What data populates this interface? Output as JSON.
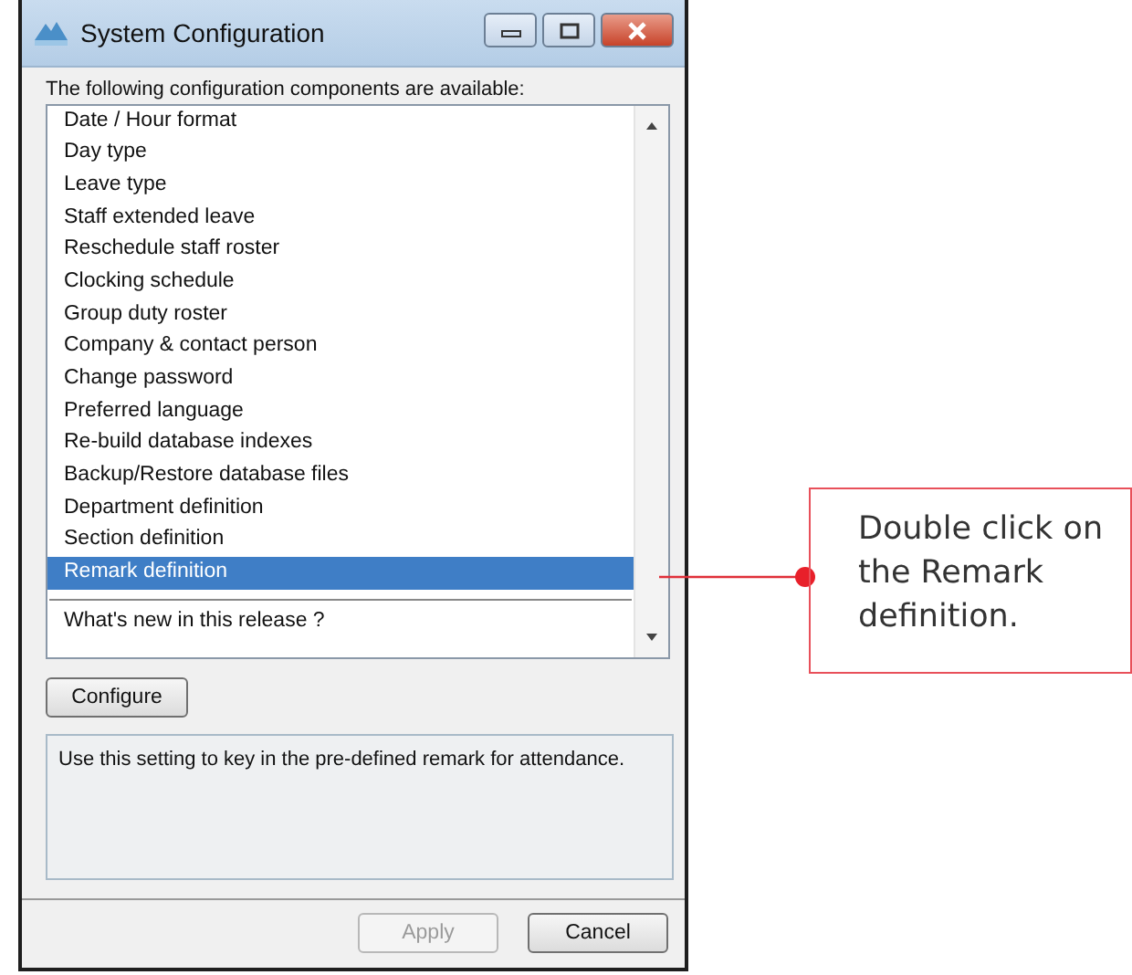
{
  "window": {
    "title": "System Configuration"
  },
  "list_label": "The following configuration components are available:",
  "items": [
    {
      "kind": "option",
      "label": "Date / Hour format",
      "selected": false
    },
    {
      "kind": "option",
      "label": "Day type",
      "selected": false
    },
    {
      "kind": "option",
      "label": "Leave type",
      "selected": false
    },
    {
      "kind": "option",
      "label": "Staff extended leave",
      "selected": false
    },
    {
      "kind": "option",
      "label": "Reschedule staff roster",
      "selected": false
    },
    {
      "kind": "option",
      "label": "Clocking schedule",
      "selected": false
    },
    {
      "kind": "option",
      "label": "Group duty roster",
      "selected": false
    },
    {
      "kind": "option",
      "label": "Company & contact person",
      "selected": false
    },
    {
      "kind": "option",
      "label": "Change password",
      "selected": false
    },
    {
      "kind": "option",
      "label": "Preferred language",
      "selected": false
    },
    {
      "kind": "option",
      "label": "Re-build database indexes",
      "selected": false
    },
    {
      "kind": "option",
      "label": "Backup/Restore database files",
      "selected": false
    },
    {
      "kind": "option",
      "label": "Department definition",
      "selected": false
    },
    {
      "kind": "option",
      "label": "Section definition",
      "selected": false
    },
    {
      "kind": "option",
      "label": "Remark definition",
      "selected": true
    },
    {
      "kind": "divider"
    },
    {
      "kind": "option",
      "label": "What's new in this release ?",
      "selected": false
    }
  ],
  "configure_button": "Configure",
  "description": "Use this setting to key in the pre-defined remark for attendance.",
  "buttons": [
    {
      "label": "Apply",
      "disabled": true
    },
    {
      "label": "Cancel",
      "disabled": false
    }
  ],
  "callout": {
    "text": "Double click on the Remark definition."
  }
}
